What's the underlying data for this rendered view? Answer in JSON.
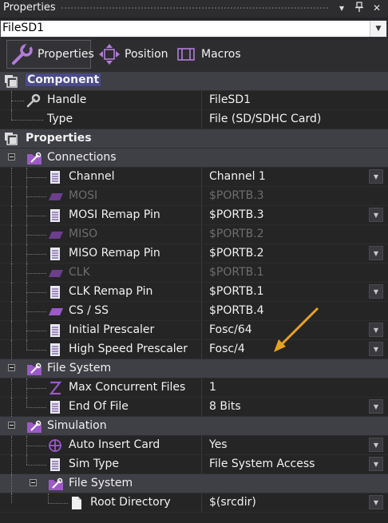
{
  "window": {
    "title": "Properties",
    "pin_glyph": "⎕",
    "close_glyph": "✕",
    "menu_glyph": "▾"
  },
  "selector": {
    "value": "FileSD1",
    "arrow_glyph": "▼"
  },
  "tabs": [
    {
      "label": "Properties",
      "icon": "wrench-icon",
      "active": true
    },
    {
      "label": "Position",
      "icon": "move-icon",
      "active": false
    },
    {
      "label": "Macros",
      "icon": "macro-icon",
      "active": false
    }
  ],
  "grid": {
    "dd_glyph": "▼",
    "component": {
      "label": "Component",
      "rows": [
        {
          "label": "Handle",
          "value": "FileSD1",
          "icon": "wrench-icon"
        },
        {
          "label": "Type",
          "value": "File (SD/SDHC Card)",
          "icon": "none"
        }
      ]
    },
    "properties": {
      "label": "Properties",
      "connections": {
        "label": "Connections",
        "rows": [
          {
            "label": "Channel",
            "value": "Channel 1",
            "icon": "list-icon",
            "dropdown": true,
            "dim": false
          },
          {
            "label": "MOSI",
            "value": "$PORTB.3",
            "icon": "pin-icon",
            "dropdown": false,
            "dim": true
          },
          {
            "label": "MOSI Remap Pin",
            "value": "$PORTB.3",
            "icon": "list-icon",
            "dropdown": true,
            "dim": false
          },
          {
            "label": "MISO",
            "value": "$PORTB.2",
            "icon": "pin-icon",
            "dropdown": false,
            "dim": true
          },
          {
            "label": "MISO Remap Pin",
            "value": "$PORTB.2",
            "icon": "list-icon",
            "dropdown": true,
            "dim": false
          },
          {
            "label": "CLK",
            "value": "$PORTB.1",
            "icon": "pin-icon",
            "dropdown": false,
            "dim": true
          },
          {
            "label": "CLK Remap Pin",
            "value": "$PORTB.1",
            "icon": "list-icon",
            "dropdown": true,
            "dim": false
          },
          {
            "label": "CS / SS",
            "value": "$PORTB.4",
            "icon": "pin-icon",
            "dropdown": false,
            "dim": false
          },
          {
            "label": "Initial Prescaler",
            "value": "Fosc/64",
            "icon": "list-icon",
            "dropdown": true,
            "dim": false
          },
          {
            "label": "High Speed Prescaler",
            "value": "Fosc/4",
            "icon": "list-icon",
            "dropdown": true,
            "dim": false
          }
        ]
      },
      "file_system": {
        "label": "File System",
        "rows": [
          {
            "label": "Max Concurrent Files",
            "value": "1",
            "icon": "z-icon",
            "dropdown": false,
            "dim": false
          },
          {
            "label": "End Of File",
            "value": "8 Bits",
            "icon": "list-icon",
            "dropdown": true,
            "dim": false
          }
        ]
      },
      "simulation": {
        "label": "Simulation",
        "rows": [
          {
            "label": "Auto Insert Card",
            "value": "Yes",
            "icon": "target-icon",
            "dropdown": true,
            "dim": false
          },
          {
            "label": "Sim Type",
            "value": "File System Access",
            "icon": "list-icon",
            "dropdown": true,
            "dim": false
          }
        ],
        "file_system": {
          "label": "File System",
          "rows": [
            {
              "label": "Root Directory",
              "value": "$(srcdir)",
              "icon": "file-icon",
              "dropdown": true,
              "dim": false
            }
          ]
        }
      }
    }
  },
  "colors": {
    "accent": "#9b59c9",
    "arrow": "#e8a31a",
    "category_bg": "#3f3f46",
    "background": "#252526",
    "selected_category": "#4a4a8a"
  }
}
